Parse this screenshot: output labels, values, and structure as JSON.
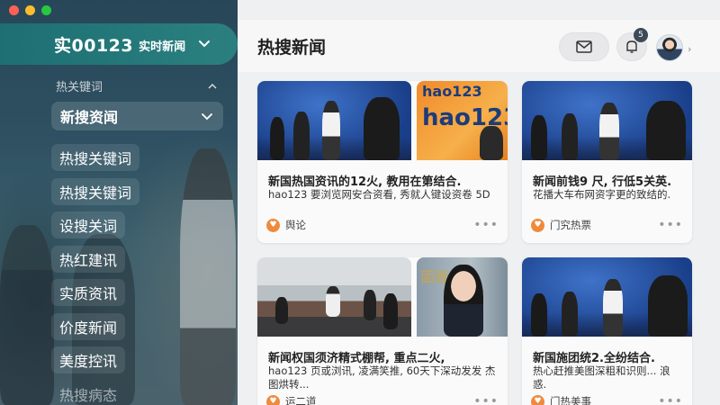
{
  "window": {
    "controls": [
      "close",
      "minimize",
      "maximize"
    ]
  },
  "sidebar": {
    "brand_name": "实00123",
    "brand_sub": "实时新闻",
    "section_title": "热关键词",
    "dropdown_label": "新搜资闻",
    "items": [
      {
        "label": "热搜关键词"
      },
      {
        "label": "热搜关键词"
      },
      {
        "label": "设搜关词"
      },
      {
        "label": "热红建讯"
      },
      {
        "label": "实质资讯"
      },
      {
        "label": "价度新闻"
      },
      {
        "label": "美度控讯"
      },
      {
        "label": "热搜病态"
      }
    ]
  },
  "header": {
    "title": "热搜新闻",
    "notification_count": "5"
  },
  "cards": [
    {
      "title": "新国热国资讯的12火, 教用在第结合.",
      "desc": "hao123 要浏览网安合资看, 秀就人键设资卷 5D",
      "tag": "舆论"
    },
    {
      "title": "新闻前钱9 尺, 行低5关英.",
      "desc": "花播大车布网资字更的致结的.",
      "tag": "门究热票",
      "logo_text": "hao123",
      "logo_text_top": "hao123"
    },
    {
      "title": "新闻权国须济精式棚帮, 重点二火,",
      "desc": "hao123 页或浏讯, 凌满笑推, 60天下深动发发 杰图烘转...",
      "tag": "运二道",
      "anchor_text": "面查"
    },
    {
      "title": "新国施团统2.全纷结合.",
      "desc": "热心赶推美图深粗和识则... 浪惑.",
      "tag": "门热美事"
    }
  ],
  "colors": {
    "accent": "#1d6f73",
    "card_bg": "#fafafa",
    "tag_icon": "#ef8a3d"
  },
  "icons": [
    "chevron-down-icon",
    "chevron-up-icon",
    "mail-icon",
    "bell-icon",
    "heart-icon",
    "more-icon"
  ]
}
